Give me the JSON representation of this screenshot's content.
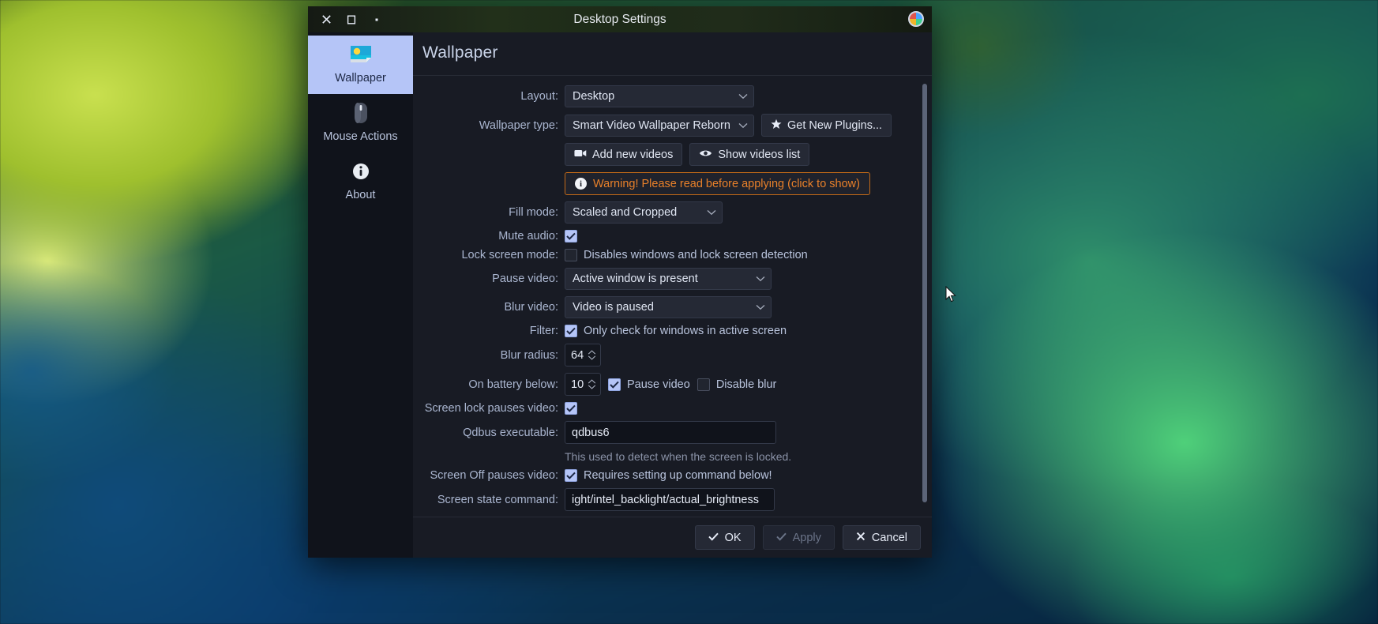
{
  "window": {
    "title": "Desktop Settings",
    "close_icon": "close-icon",
    "maximize_icon": "maximize-icon",
    "minimize_icon": "minimize-icon",
    "app_icon": "plasma-app-icon"
  },
  "sidebar": {
    "items": [
      {
        "label": "Wallpaper",
        "icon": "wallpaper-icon",
        "active": true
      },
      {
        "label": "Mouse Actions",
        "icon": "mouse-icon",
        "active": false
      },
      {
        "label": "About",
        "icon": "info-icon",
        "active": false
      }
    ]
  },
  "page": {
    "title": "Wallpaper"
  },
  "form": {
    "layout": {
      "label": "Layout:",
      "value": "Desktop"
    },
    "wallpaper_type": {
      "label": "Wallpaper type:",
      "value": "Smart Video Wallpaper Reborn",
      "get_new_plugins": "Get New Plugins..."
    },
    "video_buttons": {
      "add_new_videos": "Add new videos",
      "show_videos_list": "Show videos list"
    },
    "warning": {
      "text": "Warning! Please read before applying (click to show)",
      "color": "#e8802a"
    },
    "fill_mode": {
      "label": "Fill mode:",
      "value": "Scaled and Cropped"
    },
    "mute_audio": {
      "label": "Mute audio:",
      "checked": true
    },
    "lock_screen_mode": {
      "label": "Lock screen mode:",
      "checkbox_label": "Disables windows and lock screen detection",
      "checked": false
    },
    "pause_video": {
      "label": "Pause video:",
      "value": "Active window is present"
    },
    "blur_video": {
      "label": "Blur video:",
      "value": "Video is paused"
    },
    "filter": {
      "label": "Filter:",
      "checkbox_label": "Only check for windows in active screen",
      "checked": true
    },
    "blur_radius": {
      "label": "Blur radius:",
      "value": "64"
    },
    "on_battery_below": {
      "label": "On battery below:",
      "value": "10",
      "pause_video_label": "Pause video",
      "pause_video_checked": true,
      "disable_blur_label": "Disable blur",
      "disable_blur_checked": false
    },
    "screen_lock_pauses_video": {
      "label": "Screen lock pauses video:",
      "checked": true
    },
    "qdbus_executable": {
      "label": "Qdbus executable:",
      "value": "qdbus6",
      "hint": "This used to detect when the screen is locked."
    },
    "screen_off_pauses_video": {
      "label": "Screen Off pauses video:",
      "checkbox_label": "Requires setting up command below!",
      "checked": true
    },
    "screen_state_command": {
      "label": "Screen state command:",
      "value": "ight/intel_backlight/actual_brightness"
    }
  },
  "buttons": {
    "ok": "OK",
    "apply": "Apply",
    "cancel": "Cancel",
    "apply_disabled": true
  }
}
